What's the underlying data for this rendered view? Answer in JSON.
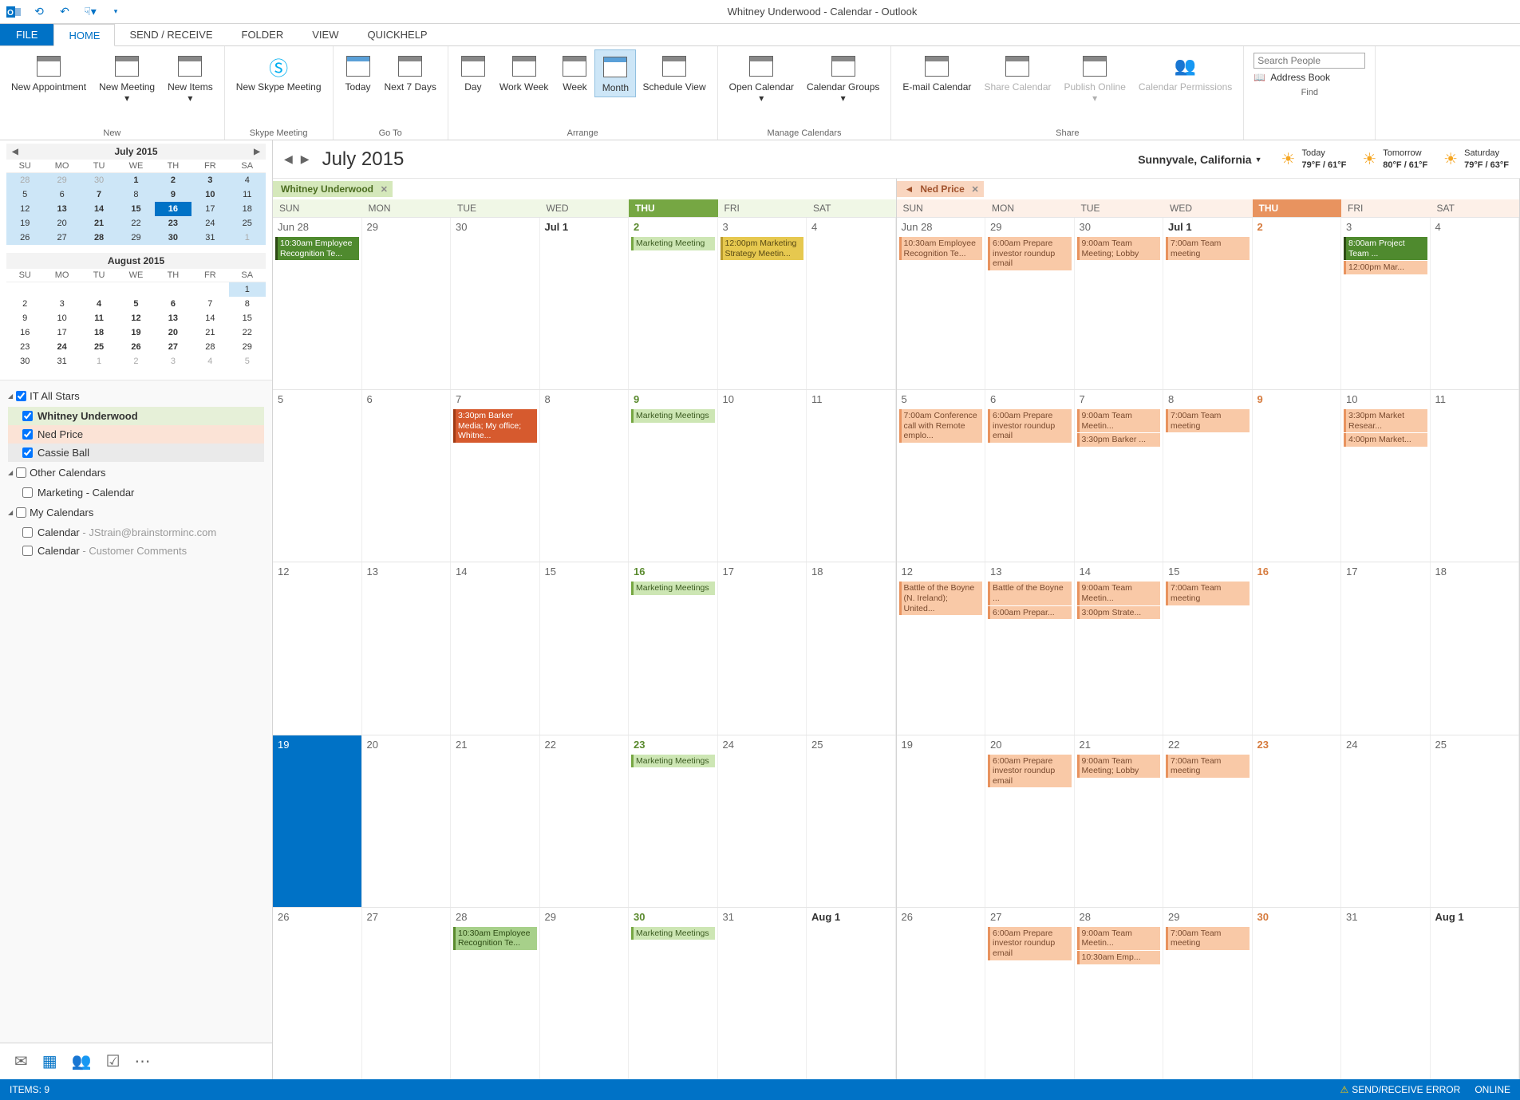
{
  "title": "Whitney Underwood - Calendar - Outlook",
  "ribbonTabs": {
    "file": "FILE",
    "home": "HOME",
    "sendrecv": "SEND / RECEIVE",
    "folder": "FOLDER",
    "view": "VIEW",
    "quickhelp": "QUICKHELP"
  },
  "ribbon": {
    "newAppt": "New Appointment",
    "newMeeting": "New Meeting",
    "newItems": "New Items",
    "groupNew": "New",
    "skype": "New Skype Meeting",
    "groupSkype": "Skype Meeting",
    "today": "Today",
    "next7": "Next 7 Days",
    "groupGoto": "Go To",
    "day": "Day",
    "workweek": "Work Week",
    "week": "Week",
    "month": "Month",
    "schedule": "Schedule View",
    "groupArrange": "Arrange",
    "openCal": "Open Calendar",
    "calGroups": "Calendar Groups",
    "groupManage": "Manage Calendars",
    "email": "E-mail Calendar",
    "share": "Share Calendar",
    "publish": "Publish Online",
    "perms": "Calendar Permissions",
    "groupShare": "Share",
    "searchPeople": "Search People",
    "addressBook": "Address Book",
    "groupFind": "Find"
  },
  "minical1": {
    "title": "July 2015",
    "dow": [
      "SU",
      "MO",
      "TU",
      "WE",
      "TH",
      "FR",
      "SA"
    ],
    "days": [
      {
        "n": 28,
        "dim": true,
        "r": true
      },
      {
        "n": 29,
        "dim": true,
        "r": true
      },
      {
        "n": 30,
        "dim": true,
        "r": true
      },
      {
        "n": 1,
        "b": true,
        "r": true
      },
      {
        "n": 2,
        "b": true,
        "r": true
      },
      {
        "n": 3,
        "b": true,
        "r": true
      },
      {
        "n": 4,
        "r": true
      },
      {
        "n": 5,
        "r": true
      },
      {
        "n": 6,
        "r": true
      },
      {
        "n": 7,
        "b": true,
        "r": true
      },
      {
        "n": 8,
        "r": true
      },
      {
        "n": 9,
        "b": true,
        "r": true
      },
      {
        "n": 10,
        "b": true,
        "r": true
      },
      {
        "n": 11,
        "r": true
      },
      {
        "n": 12,
        "r": true
      },
      {
        "n": 13,
        "b": true,
        "r": true
      },
      {
        "n": 14,
        "b": true,
        "r": true
      },
      {
        "n": 15,
        "b": true,
        "r": true
      },
      {
        "n": 16,
        "sel": true
      },
      {
        "n": 17,
        "r": true
      },
      {
        "n": 18,
        "r": true
      },
      {
        "n": 19,
        "r": true
      },
      {
        "n": 20,
        "r": true
      },
      {
        "n": 21,
        "b": true,
        "r": true
      },
      {
        "n": 22,
        "r": true
      },
      {
        "n": 23,
        "b": true,
        "r": true
      },
      {
        "n": 24,
        "r": true
      },
      {
        "n": 25,
        "r": true
      },
      {
        "n": 26,
        "r": true
      },
      {
        "n": 27,
        "r": true
      },
      {
        "n": 28,
        "b": true,
        "r": true
      },
      {
        "n": 29,
        "r": true
      },
      {
        "n": 30,
        "b": true,
        "r": true
      },
      {
        "n": 31,
        "r": true
      },
      {
        "n": 1,
        "dim": true,
        "r": true
      }
    ]
  },
  "minical2": {
    "title": "August 2015",
    "dow": [
      "SU",
      "MO",
      "TU",
      "WE",
      "TH",
      "FR",
      "SA"
    ],
    "days": [
      {
        "n": "",
        "dim": true
      },
      {
        "n": "",
        "dim": true
      },
      {
        "n": "",
        "dim": true
      },
      {
        "n": "",
        "dim": true
      },
      {
        "n": "",
        "dim": true
      },
      {
        "n": "",
        "dim": true
      },
      {
        "n": 1,
        "r": true
      },
      {
        "n": 2
      },
      {
        "n": 3
      },
      {
        "n": 4,
        "b": true
      },
      {
        "n": 5,
        "b": true
      },
      {
        "n": 6,
        "b": true
      },
      {
        "n": 7
      },
      {
        "n": 8
      },
      {
        "n": 9
      },
      {
        "n": 10
      },
      {
        "n": 11,
        "b": true
      },
      {
        "n": 12,
        "b": true
      },
      {
        "n": 13,
        "b": true
      },
      {
        "n": 14
      },
      {
        "n": 15
      },
      {
        "n": 16
      },
      {
        "n": 17
      },
      {
        "n": 18,
        "b": true
      },
      {
        "n": 19,
        "b": true
      },
      {
        "n": 20,
        "b": true
      },
      {
        "n": 21
      },
      {
        "n": 22
      },
      {
        "n": 23
      },
      {
        "n": 24,
        "b": true
      },
      {
        "n": 25,
        "b": true
      },
      {
        "n": 26,
        "b": true
      },
      {
        "n": 27,
        "b": true
      },
      {
        "n": 28
      },
      {
        "n": 29
      },
      {
        "n": 30
      },
      {
        "n": 31
      },
      {
        "n": 1,
        "dim": true
      },
      {
        "n": 2,
        "dim": true
      },
      {
        "n": 3,
        "dim": true
      },
      {
        "n": 4,
        "dim": true
      },
      {
        "n": 5,
        "dim": true
      }
    ]
  },
  "folders": {
    "g1": "IT All Stars",
    "whitney": "Whitney Underwood",
    "ned": "Ned Price",
    "cassie": "Cassie Ball",
    "g2": "Other Calendars",
    "marketing": "Marketing - Calendar",
    "g3": "My Calendars",
    "cal1a": "Calendar",
    "cal1b": " - JStrain@brainstorminc.com",
    "cal2a": "Calendar",
    "cal2b": " - Customer Comments"
  },
  "calHeader": {
    "month": "July 2015",
    "location": "Sunnyvale, California",
    "w1day": "Today",
    "w1temp": "79°F / 61°F",
    "w2day": "Tomorrow",
    "w2temp": "80°F / 61°F",
    "w3day": "Saturday",
    "w3temp": "79°F / 63°F"
  },
  "dow": [
    "SUN",
    "MON",
    "TUE",
    "WED",
    "THU",
    "FRI",
    "SAT"
  ],
  "whitneyTab": "Whitney Underwood",
  "nedTab": "Ned Price",
  "whitneyWeeks": [
    [
      {
        "n": "Jun 28",
        "evts": [
          {
            "c": "darkgreen",
            "t": "10:30am Employee Recognition Te..."
          }
        ]
      },
      {
        "n": "29"
      },
      {
        "n": "30"
      },
      {
        "n": "Jul 1",
        "bold": true
      },
      {
        "n": "2",
        "thu": true,
        "evts": [
          {
            "c": "lgreen",
            "t": "Marketing Meeting"
          }
        ]
      },
      {
        "n": "3",
        "evts": [
          {
            "c": "yellow",
            "t": "12:00pm Marketing Strategy Meetin..."
          }
        ]
      },
      {
        "n": "4"
      }
    ],
    [
      {
        "n": "5"
      },
      {
        "n": "6"
      },
      {
        "n": "7",
        "evts": [
          {
            "c": "dorange",
            "t": "3:30pm Barker Media; My office; Whitne..."
          }
        ]
      },
      {
        "n": "8"
      },
      {
        "n": "9",
        "thu": true,
        "evts": [
          {
            "c": "lgreen",
            "t": "Marketing Meetings"
          }
        ]
      },
      {
        "n": "10"
      },
      {
        "n": "11"
      }
    ],
    [
      {
        "n": "12"
      },
      {
        "n": "13"
      },
      {
        "n": "14"
      },
      {
        "n": "15"
      },
      {
        "n": "16",
        "thu": true,
        "evts": [
          {
            "c": "lgreen",
            "t": "Marketing Meetings"
          }
        ]
      },
      {
        "n": "17"
      },
      {
        "n": "18"
      }
    ],
    [
      {
        "n": "19",
        "today": true
      },
      {
        "n": "20"
      },
      {
        "n": "21"
      },
      {
        "n": "22"
      },
      {
        "n": "23",
        "thu": true,
        "evts": [
          {
            "c": "lgreen",
            "t": "Marketing Meetings"
          }
        ]
      },
      {
        "n": "24"
      },
      {
        "n": "25"
      }
    ],
    [
      {
        "n": "26"
      },
      {
        "n": "27"
      },
      {
        "n": "28",
        "evts": [
          {
            "c": "green",
            "t": "10:30am Employee Recognition Te..."
          }
        ]
      },
      {
        "n": "29"
      },
      {
        "n": "30",
        "thu": true,
        "evts": [
          {
            "c": "lgreen",
            "t": "Marketing Meetings"
          }
        ]
      },
      {
        "n": "31"
      },
      {
        "n": "Aug 1",
        "bold": true
      }
    ]
  ],
  "nedWeeks": [
    [
      {
        "n": "Jun 28",
        "evts": [
          {
            "c": "norange",
            "t": "10:30am Employee Recognition Te..."
          }
        ]
      },
      {
        "n": "29",
        "evts": [
          {
            "c": "norange",
            "t": "6:00am Prepare investor roundup email"
          }
        ]
      },
      {
        "n": "30",
        "evts": [
          {
            "c": "norange",
            "t": "9:00am Team Meeting; Lobby"
          }
        ]
      },
      {
        "n": "Jul 1",
        "bold": true,
        "evts": [
          {
            "c": "norange",
            "t": "7:00am Team meeting"
          }
        ]
      },
      {
        "n": "2",
        "thu": true
      },
      {
        "n": "3",
        "evts": [
          {
            "c": "darkgreen",
            "t": "8:00am Project Team ..."
          },
          {
            "c": "norange",
            "t": "12:00pm Mar..."
          }
        ]
      },
      {
        "n": "4"
      }
    ],
    [
      {
        "n": "5",
        "evts": [
          {
            "c": "norange",
            "t": "7:00am Conference call with Remote emplo..."
          }
        ]
      },
      {
        "n": "6",
        "evts": [
          {
            "c": "norange",
            "t": "6:00am Prepare investor roundup email"
          }
        ]
      },
      {
        "n": "7",
        "evts": [
          {
            "c": "norange",
            "t": "9:00am Team Meetin..."
          },
          {
            "c": "norange",
            "t": "3:30pm Barker ..."
          }
        ]
      },
      {
        "n": "8",
        "evts": [
          {
            "c": "norange",
            "t": "7:00am Team meeting"
          }
        ]
      },
      {
        "n": "9",
        "thu": true
      },
      {
        "n": "10",
        "evts": [
          {
            "c": "norange",
            "t": "3:30pm Market Resear..."
          },
          {
            "c": "norange",
            "t": "4:00pm Market..."
          }
        ]
      },
      {
        "n": "11"
      }
    ],
    [
      {
        "n": "12",
        "evts": [
          {
            "c": "norange",
            "t": "Battle of the Boyne (N. Ireland); United..."
          }
        ]
      },
      {
        "n": "13",
        "evts": [
          {
            "c": "norange",
            "t": "Battle of the Boyne ..."
          },
          {
            "c": "norange",
            "t": "6:00am Prepar..."
          }
        ]
      },
      {
        "n": "14",
        "evts": [
          {
            "c": "norange",
            "t": "9:00am Team Meetin..."
          },
          {
            "c": "norange",
            "t": "3:00pm Strate..."
          }
        ]
      },
      {
        "n": "15",
        "evts": [
          {
            "c": "norange",
            "t": "7:00am Team meeting"
          }
        ]
      },
      {
        "n": "16",
        "thu": true
      },
      {
        "n": "17"
      },
      {
        "n": "18"
      }
    ],
    [
      {
        "n": "19"
      },
      {
        "n": "20",
        "evts": [
          {
            "c": "norange",
            "t": "6:00am Prepare investor roundup email"
          }
        ]
      },
      {
        "n": "21",
        "evts": [
          {
            "c": "norange",
            "t": "9:00am Team Meeting; Lobby"
          }
        ]
      },
      {
        "n": "22",
        "evts": [
          {
            "c": "norange",
            "t": "7:00am Team meeting"
          }
        ]
      },
      {
        "n": "23",
        "thu": true
      },
      {
        "n": "24"
      },
      {
        "n": "25"
      }
    ],
    [
      {
        "n": "26"
      },
      {
        "n": "27",
        "evts": [
          {
            "c": "norange",
            "t": "6:00am Prepare investor roundup email"
          }
        ]
      },
      {
        "n": "28",
        "evts": [
          {
            "c": "norange",
            "t": "9:00am Team Meetin..."
          },
          {
            "c": "norange",
            "t": "10:30am Emp..."
          }
        ]
      },
      {
        "n": "29",
        "evts": [
          {
            "c": "norange",
            "t": "7:00am Team meeting"
          }
        ]
      },
      {
        "n": "30",
        "thu": true
      },
      {
        "n": "31"
      },
      {
        "n": "Aug 1",
        "bold": true
      }
    ]
  ],
  "status": {
    "items": "ITEMS: 9",
    "err": "SEND/RECEIVE ERROR",
    "online": "ONLINE"
  }
}
